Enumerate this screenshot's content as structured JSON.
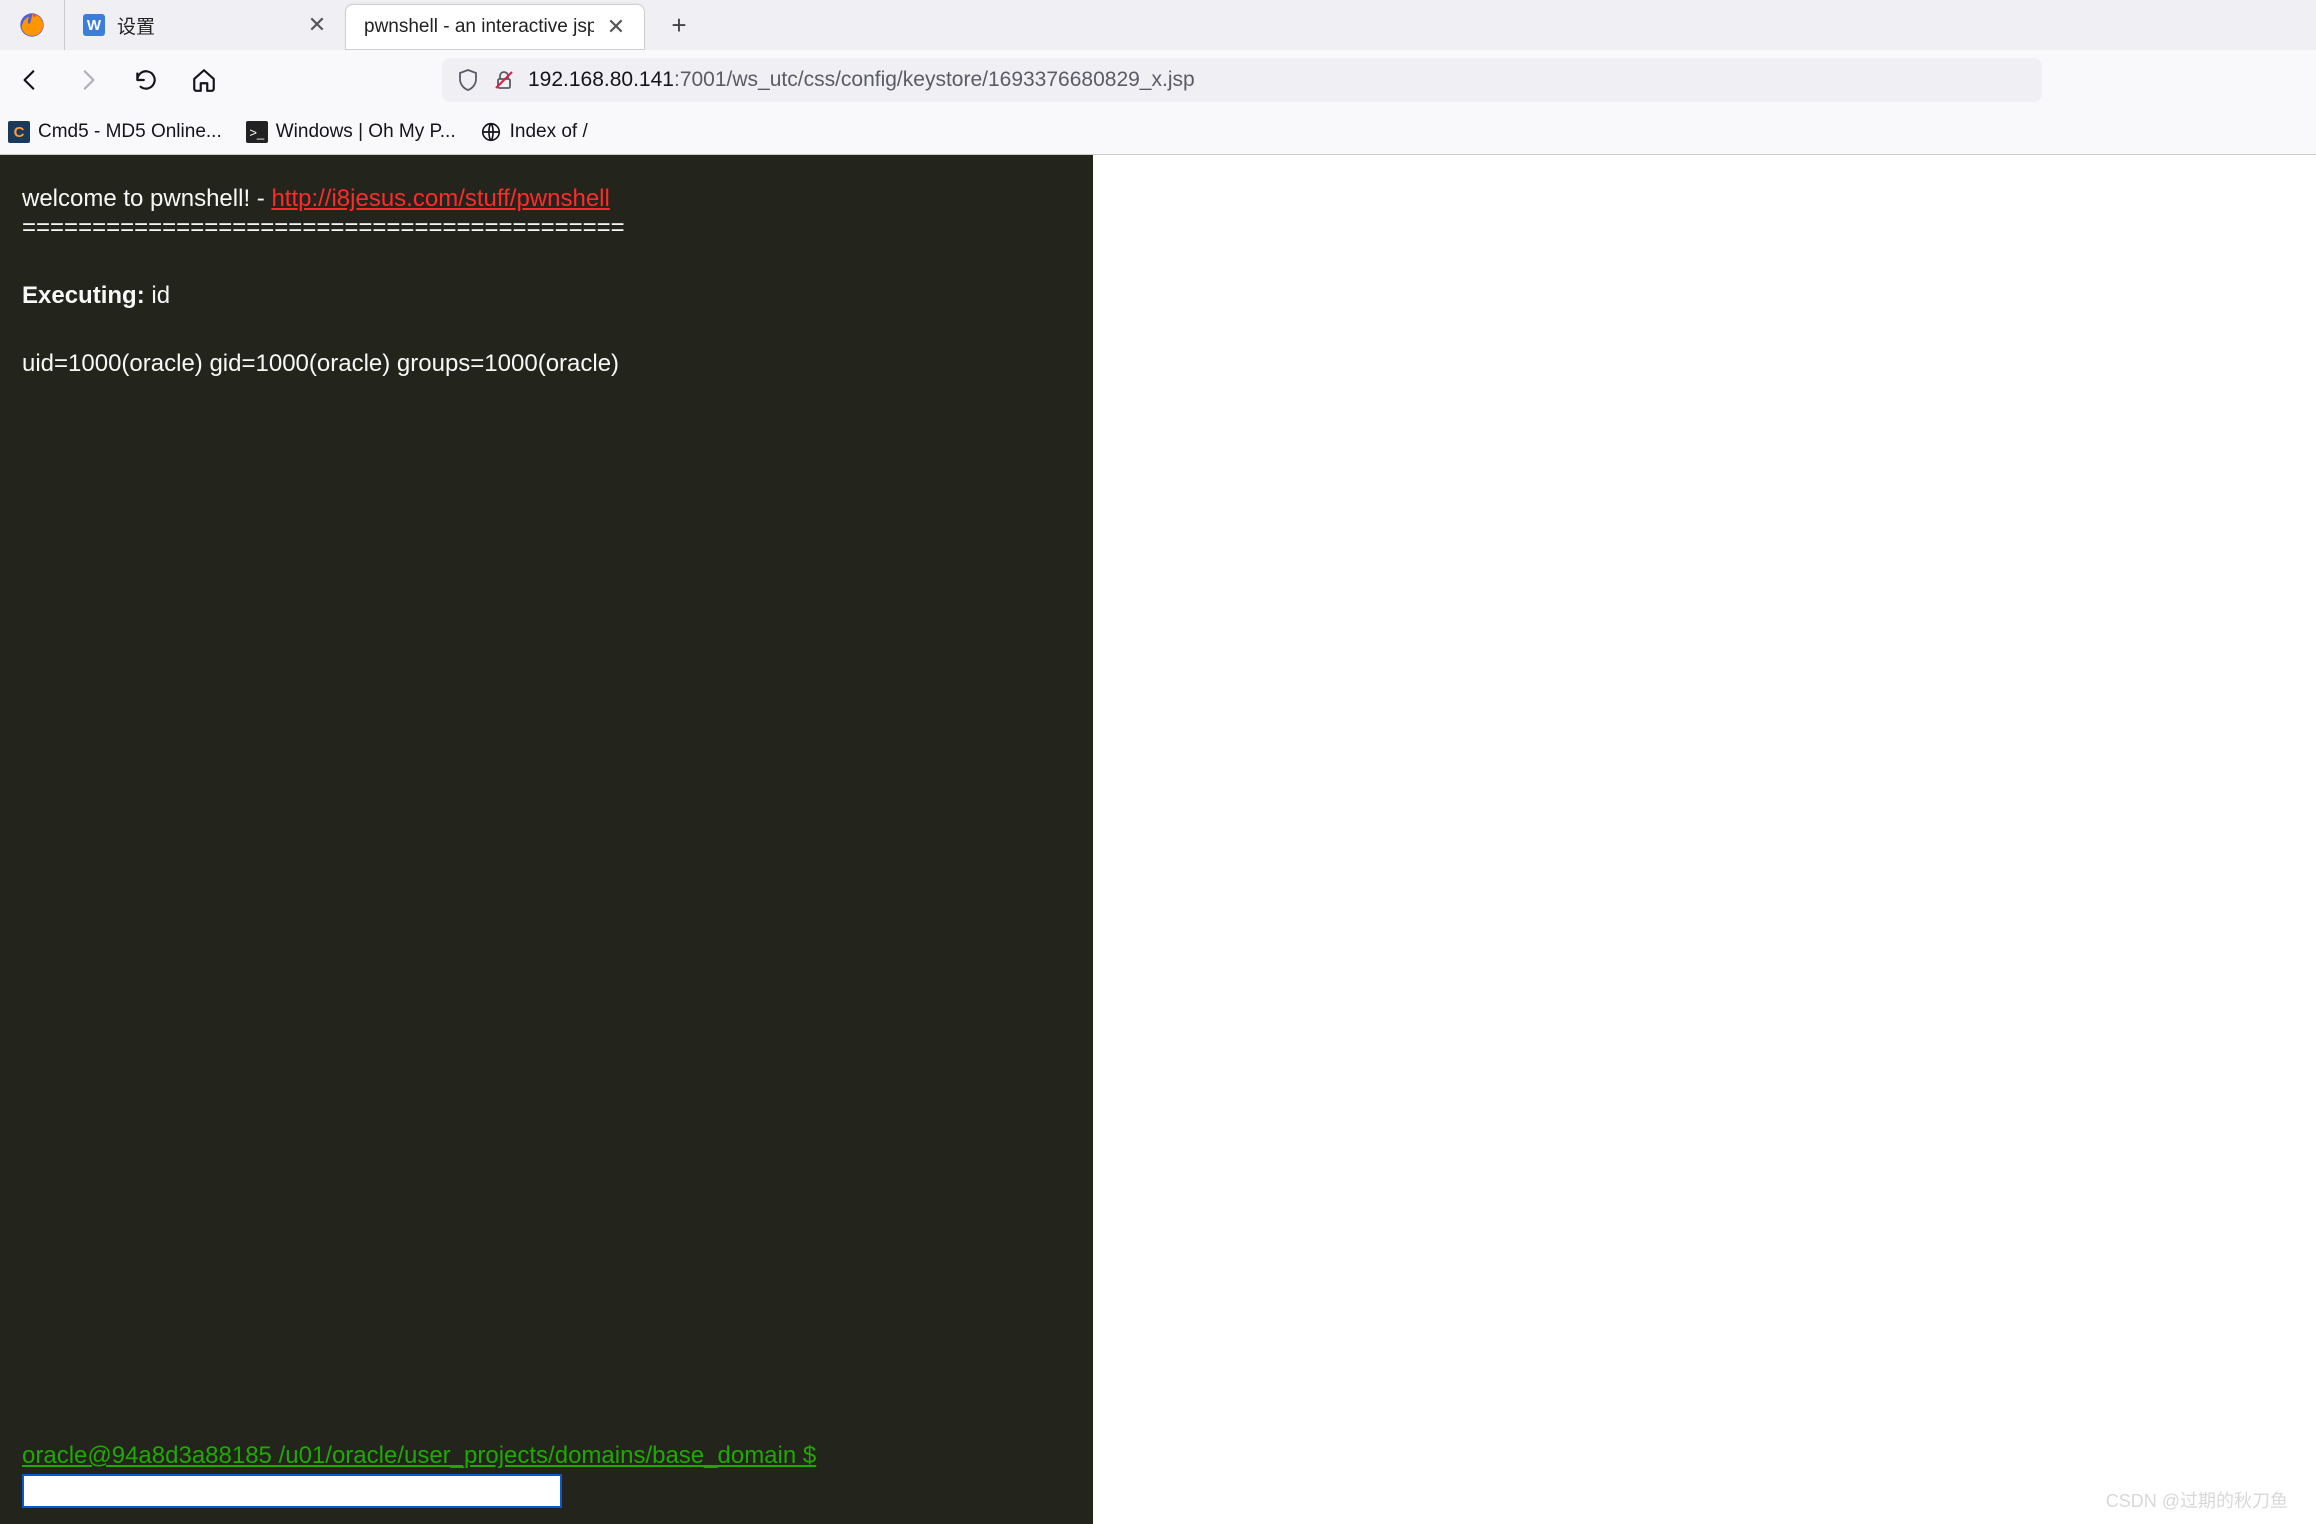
{
  "tabs": {
    "pinned_icon": "firefox",
    "inactive": {
      "title": "设置",
      "favicon_letter": "W"
    },
    "active": {
      "title": "pwnshell - an interactive jsp shell"
    }
  },
  "url": {
    "host": "192.168.80.141",
    "rest": ":7001/ws_utc/css/config/keystore/1693376680829_x.jsp"
  },
  "bookmarks": [
    {
      "label": "Cmd5 - MD5 Online...",
      "icon": "c-orange"
    },
    {
      "label": "Windows | Oh My P...",
      "icon": "terminal"
    },
    {
      "label": "Index of /",
      "icon": "globe"
    }
  ],
  "shell": {
    "welcome_prefix": "welcome to pwnshell! - ",
    "welcome_link": "http://i8jesus.com/stuff/pwnshell",
    "divider": "===========================================",
    "exec_label": "Executing:",
    "exec_cmd": " id",
    "output": "uid=1000(oracle) gid=1000(oracle) groups=1000(oracle)",
    "prompt": "oracle@94a8d3a88185 /u01/oracle/user_projects/domains/base_domain $",
    "input_value": ""
  },
  "watermark": "CSDN @过期的秋刀鱼"
}
